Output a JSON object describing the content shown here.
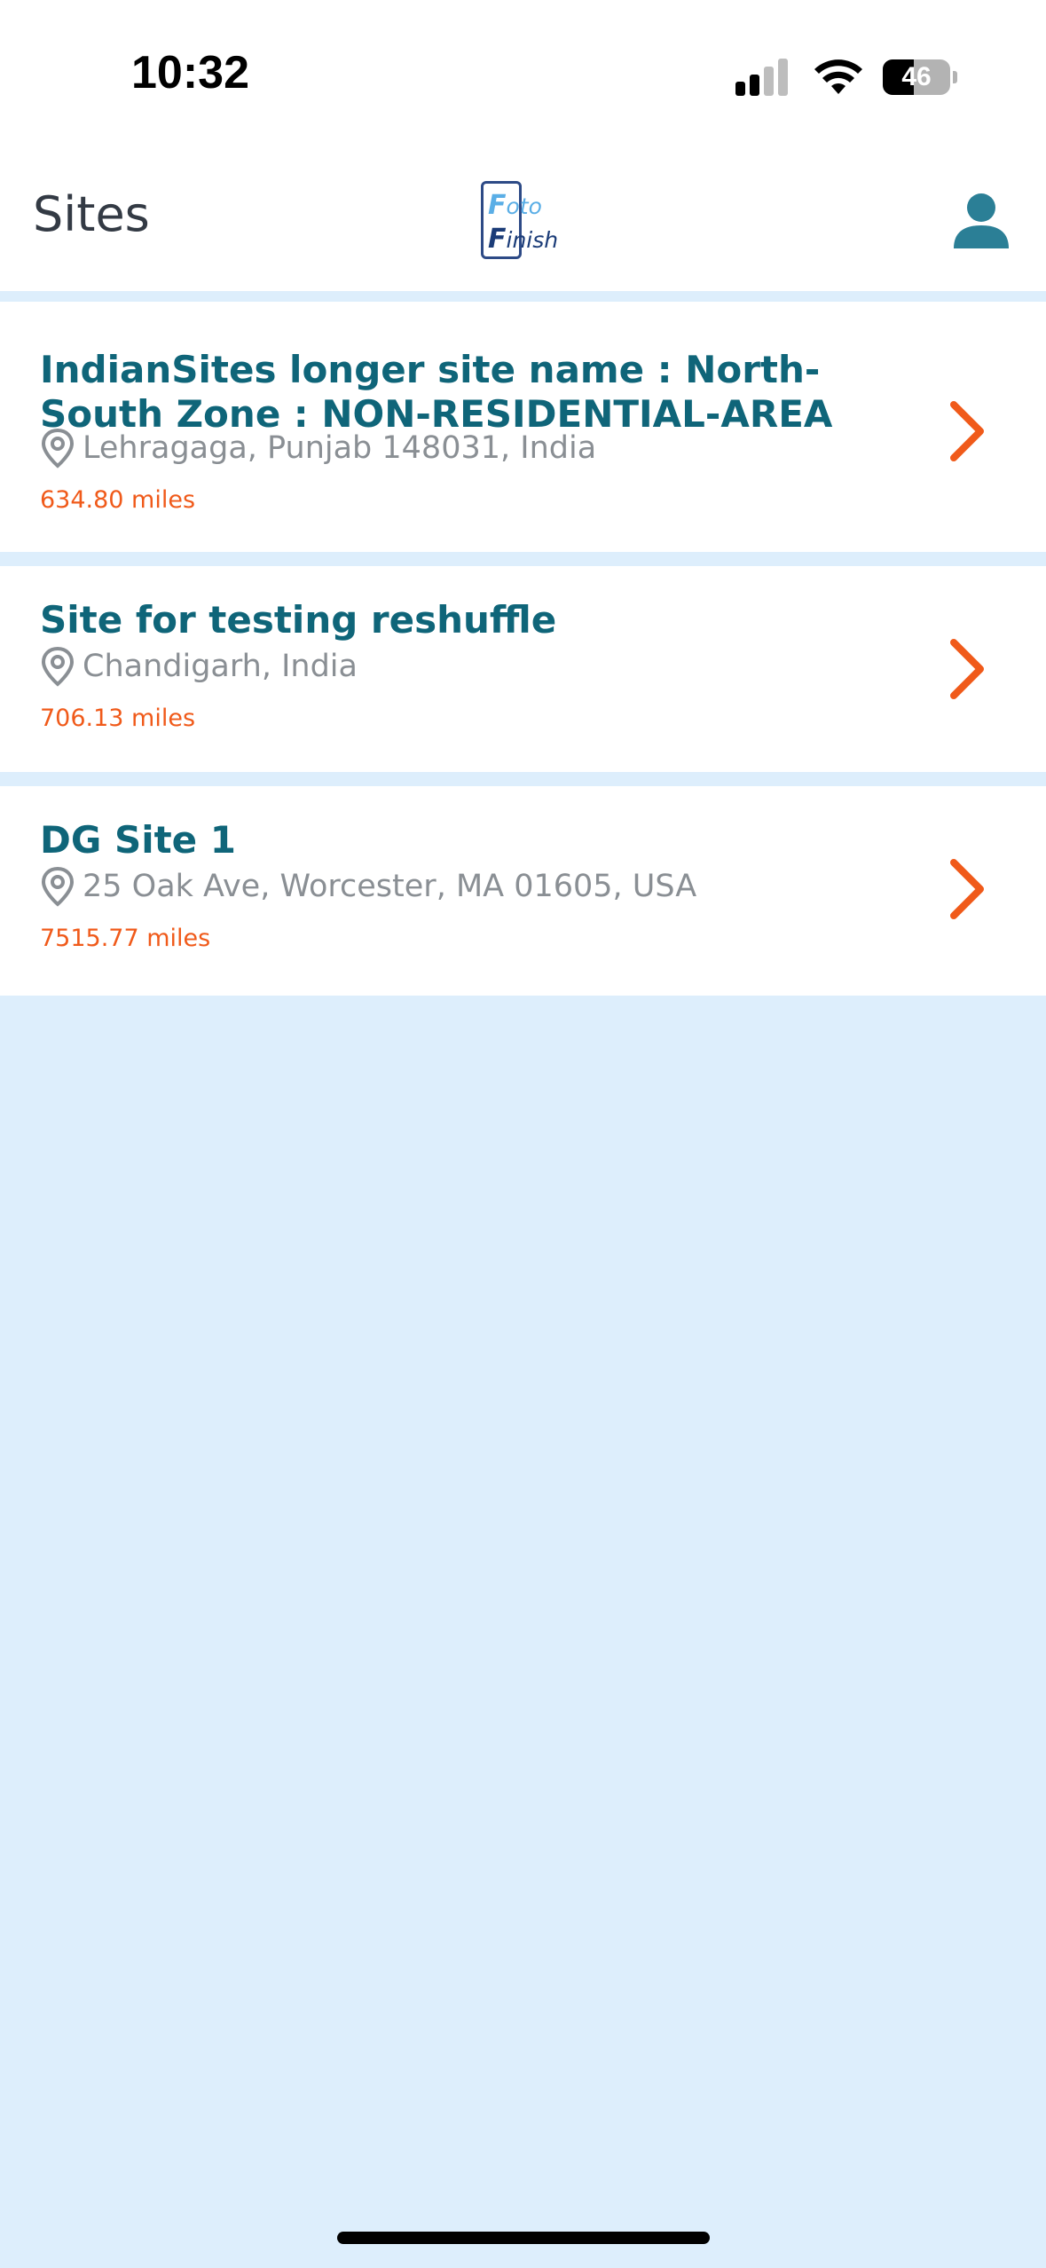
{
  "status_bar": {
    "time": "10:32",
    "battery_level": "46",
    "battery_fraction": 0.46,
    "signal_icon": "cellular-signal-icon",
    "wifi_icon": "wifi-icon"
  },
  "header": {
    "title": "Sites",
    "logo": {
      "line1_initial": "F",
      "line1_rest": "oto",
      "line2_initial": "F",
      "line2_rest": "inish"
    },
    "profile_icon": "user-icon"
  },
  "sites": [
    {
      "name": "IndianSites  longer site name : North-South Zone : NON-RESIDENTIAL-AREA",
      "address": "Lehragaga, Punjab 148031, India",
      "distance": "634.80 miles"
    },
    {
      "name": "Site for testing reshuffle",
      "address": "Chandigarh, India",
      "distance": "706.13 miles"
    },
    {
      "name": "DG Site 1",
      "address": "25 Oak Ave, Worcester, MA 01605, USA",
      "distance": "7515.77 miles"
    }
  ],
  "colors": {
    "accent": "#f05a1a",
    "title": "#0f6579",
    "background": "#ddeefc",
    "profile_icon": "#2b7f96"
  }
}
